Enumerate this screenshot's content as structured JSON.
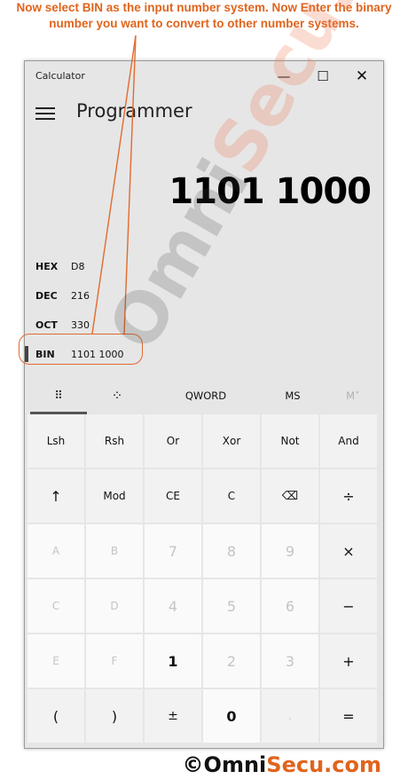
{
  "caption": "Now select BIN as the input number system. Now Enter the binary number  you want to convert to other number systems.",
  "window": {
    "title": "Calculator",
    "minimize_glyph": "—",
    "maximize_glyph": "☐",
    "close_glyph": "✕"
  },
  "header": {
    "mode": "Programmer"
  },
  "display": {
    "value": "1101 1000"
  },
  "radix": [
    {
      "label": "HEX",
      "value": "D8"
    },
    {
      "label": "DEC",
      "value": "216"
    },
    {
      "label": "OCT",
      "value": "330"
    },
    {
      "label": "BIN",
      "value": "1101 1000",
      "selected": true
    }
  ],
  "tabs": {
    "full_keypad_glyph": "⠿",
    "bit_toggle_glyph": "⁘",
    "word_size": "QWORD",
    "memory_store": "MS",
    "memory_recall": "M˅"
  },
  "keys": [
    [
      "Lsh",
      "Rsh",
      "Or",
      "Xor",
      "Not",
      "And"
    ],
    [
      "↑",
      "Mod",
      "CE",
      "C",
      "⌫",
      "÷"
    ],
    [
      "A",
      "B",
      "7",
      "8",
      "9",
      "×"
    ],
    [
      "C",
      "D",
      "4",
      "5",
      "6",
      "−"
    ],
    [
      "E",
      "F",
      "1",
      "2",
      "3",
      "+"
    ],
    [
      "(",
      ")",
      "±",
      "0",
      ".",
      "="
    ]
  ],
  "watermark": {
    "part1": "Omni",
    "part2": "Secu.com"
  },
  "footer": {
    "copyright": "©",
    "brand_dark": "Omni",
    "brand_accent": "Secu.com"
  },
  "colors": {
    "accent": "#e0641c",
    "window_bg": "#e6e6e6",
    "key_bg": "#f2f2f2",
    "num_key_bg": "#fafafa"
  }
}
